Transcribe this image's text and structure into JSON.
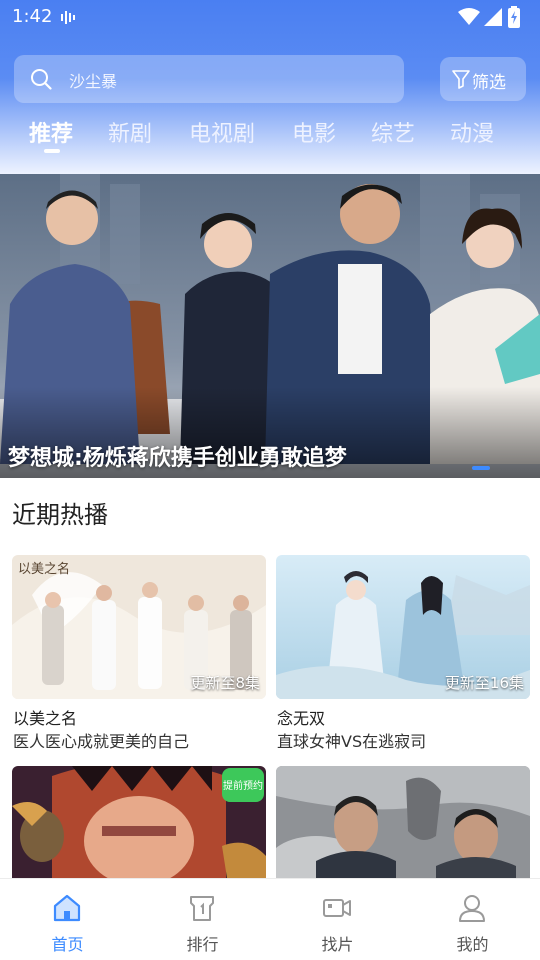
{
  "status_bar": {
    "time": "1:42"
  },
  "search": {
    "query": "沙尘暴"
  },
  "filter": {
    "label": "筛选"
  },
  "tabs": [
    {
      "label": "推荐",
      "active": true
    },
    {
      "label": "新剧",
      "active": false
    },
    {
      "label": "电视剧",
      "active": false
    },
    {
      "label": "电影",
      "active": false
    },
    {
      "label": "综艺",
      "active": false
    },
    {
      "label": "动漫",
      "active": false
    }
  ],
  "banner": {
    "caption": "梦想城:杨烁蒋欣携手创业勇敢追梦"
  },
  "section": {
    "title": "近期热播"
  },
  "cards": [
    {
      "title": "以美之名",
      "subtitle": "医人医心成就更美的自己",
      "badge": "更新至8集",
      "poster_text": "以美之名"
    },
    {
      "title": "念无双",
      "subtitle": "直球女神VS在逃寂司",
      "badge": "更新至16集"
    },
    {
      "poster_text": "提前预约"
    },
    {}
  ],
  "bottom_nav": [
    {
      "label": "首页",
      "icon": "home-icon",
      "active": true
    },
    {
      "label": "排行",
      "icon": "ranking-icon",
      "active": false
    },
    {
      "label": "找片",
      "icon": "video-camera-icon",
      "active": false
    },
    {
      "label": "我的",
      "icon": "profile-icon",
      "active": false
    }
  ],
  "colors": {
    "accent": "#3d8bff",
    "header_top": "#4a7ff2"
  }
}
